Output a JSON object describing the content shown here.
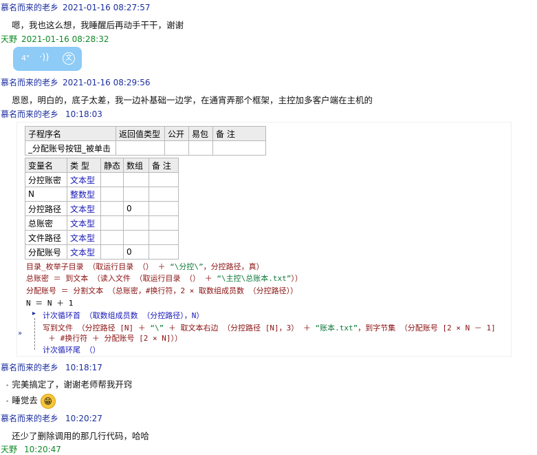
{
  "messages": [
    {
      "name": "慕名而来的老乡",
      "time": "2021-01-16 08:27:57",
      "text": "嗯，我也这么想，我睡醒后再动手干干，谢谢"
    },
    {
      "name": "天野",
      "time": "2021-01-16 08:28:32",
      "voice_duration": "4\""
    },
    {
      "name": "慕名而来的老乡",
      "time": "2021-01-16 08:29:56",
      "text": "恩恩，明白的，底子太差，我一边补基础一边学，在通宵弄那个框架，主控加多客户端在主机的"
    },
    {
      "name": "慕名而来的老乡",
      "time": "10:18:03"
    },
    {
      "name": "慕名而来的老乡",
      "time": "10:18:17",
      "lines": [
        "完美搞定了，谢谢老师帮我开窍",
        "睡觉去"
      ]
    },
    {
      "name": "慕名而来的老乡",
      "time": "10:20:27",
      "text": "还少了删除调用的那几行代码，哈哈"
    },
    {
      "name": "天野",
      "time": "10:20:47"
    }
  ],
  "icons": {
    "voice": "sound-wave-icon",
    "translate": "translate-icon",
    "emoji": "grin-emoji-icon"
  },
  "subroutine_table": {
    "headers": [
      "子程序名",
      "返回值类型",
      "公开",
      "易包",
      "备 注"
    ],
    "row": [
      "_分配账号按钮_被单击",
      "",
      "",
      "",
      ""
    ]
  },
  "var_table": {
    "headers": [
      "变量名",
      "类 型",
      "静态",
      "数组",
      "备 注"
    ],
    "rows": [
      [
        "分控账密",
        "文本型",
        "",
        "",
        ""
      ],
      [
        "N",
        "整数型",
        "",
        "",
        ""
      ],
      [
        "分控路径",
        "文本型",
        "",
        "0",
        ""
      ],
      [
        "总账密",
        "文本型",
        "",
        "",
        ""
      ],
      [
        "文件路径",
        "文本型",
        "",
        "",
        ""
      ],
      [
        "分配账号",
        "文本型",
        "",
        "0",
        ""
      ]
    ]
  },
  "code": {
    "l1_a": "目录_枚举子目录 （取运行目录 （） ＋ ",
    "l1_b": "“\\分控\\”",
    "l1_c": "，分控路径，真）",
    "l2_a": "总账密 ＝ 到文本 （读入文件 （取运行目录 （） ＋ ",
    "l2_b": "“\\主控\\总账本.txt”",
    "l2_c": "））",
    "l3": "分配账号 ＝ 分割文本 （总账密，#换行符，2 × 取数组成员数 （分控路径））",
    "l4": "N ＝ N ＋ 1",
    "l5": "计次循环首 （取数组成员数 （分控路径），N）",
    "l6_a": "写到文件 （分控路径 [N] ＋ ",
    "l6_b": "“\\”",
    "l6_c": " ＋ 取文本右边 （分控路径 [N]，3） ＋ ",
    "l6_d": "“账本.txt”",
    "l6_e": "，到字节集 （分配账号 [2 × N － 1]",
    "l7": "＋ #换行符 ＋ 分配账号 [2 × N]））",
    "l8": "计次循环尾 （）"
  }
}
